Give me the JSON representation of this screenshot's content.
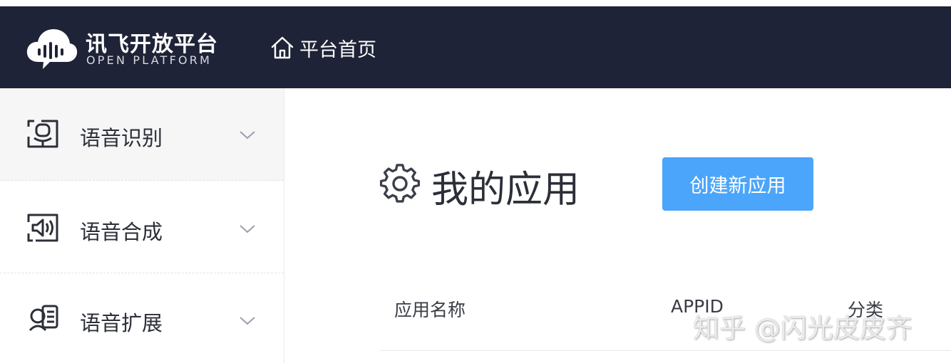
{
  "header": {
    "logo_title": "讯飞开放平台",
    "logo_subtitle": "OPEN PLATFORM",
    "home_label": "平台首页",
    "background": "#1e2337"
  },
  "sidebar": {
    "items": [
      {
        "label": "语音识别",
        "icon": "speech-recognition-icon",
        "active": true
      },
      {
        "label": "语音合成",
        "icon": "speech-synthesis-icon",
        "active": false
      },
      {
        "label": "语音扩展",
        "icon": "speech-extension-icon",
        "active": false
      }
    ]
  },
  "main": {
    "title": "我的应用",
    "create_button": "创建新应用",
    "accent": "#4ba5fb",
    "table": {
      "columns": [
        "应用名称",
        "APPID",
        "分类"
      ]
    }
  },
  "watermark": "知乎 @闪光皮皮齐"
}
